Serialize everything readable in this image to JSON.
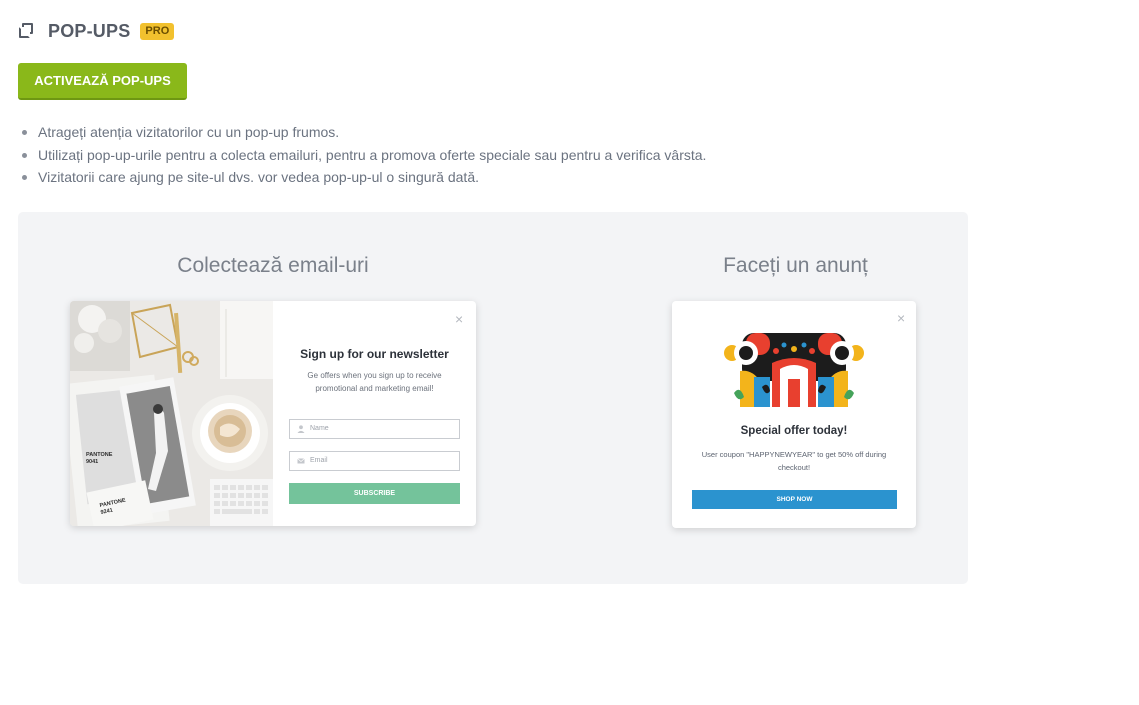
{
  "header": {
    "icon": "copy-icon",
    "title": "POP-UPS",
    "badge": "PRO"
  },
  "activate_button": "ACTIVEAZĂ POP-UPS",
  "bullets": [
    "Atrageți atenția vizitatorilor cu un pop-up frumos.",
    "Utilizați pop-up-urile pentru a colecta emailuri, pentru a promova oferte speciale sau pentru a verifica vârsta.",
    "Vizitatorii care ajung pe site-ul dvs. vor vedea pop-up-ul o singură dată."
  ],
  "examples": {
    "collect": {
      "title": "Colectează email-uri",
      "popup": {
        "heading": "Sign up for our newsletter",
        "description": "Ge offers when you sign up to receive promotional and marketing email!",
        "name_placeholder": "Name",
        "email_placeholder": "Email",
        "button": "SUBSCRIBE",
        "close": "×",
        "photo_labels": [
          "PANTONE",
          "9041",
          "PANTONE",
          "9241"
        ]
      }
    },
    "announce": {
      "title": "Faceți un anunț",
      "popup": {
        "heading": "Special offer today!",
        "description": "User coupon \"HAPPYNEWYEAR\" to get 50% off during checkout!",
        "button": "SHOP NOW",
        "close": "×"
      }
    }
  },
  "colors": {
    "activate_green": "#8ab81a",
    "pro_badge": "#f2c12e",
    "subscribe_green": "#74c39b",
    "shop_blue": "#2b93cf",
    "panel_bg": "#f3f4f6"
  }
}
